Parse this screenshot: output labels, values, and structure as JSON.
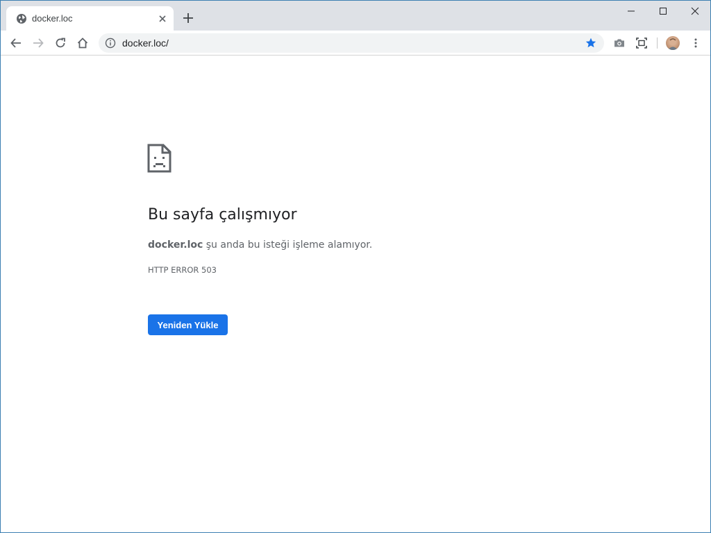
{
  "tab": {
    "title": "docker.loc",
    "favicon": "globe-icon"
  },
  "window_controls": [
    "minimize-icon",
    "maximize-icon",
    "close-icon"
  ],
  "toolbar": {
    "url": "docker.loc/",
    "bookmarked": true,
    "accent_color": "#1a73e8"
  },
  "error_page": {
    "icon": "sad-document-icon",
    "heading": "Bu sayfa çalışmıyor",
    "host": "docker.loc",
    "description": " şu anda bu isteği işleme alamıyor.",
    "error_code": "HTTP ERROR 503",
    "reload_button_label": "Yeniden Yükle",
    "button_color": "#1a73e8"
  }
}
